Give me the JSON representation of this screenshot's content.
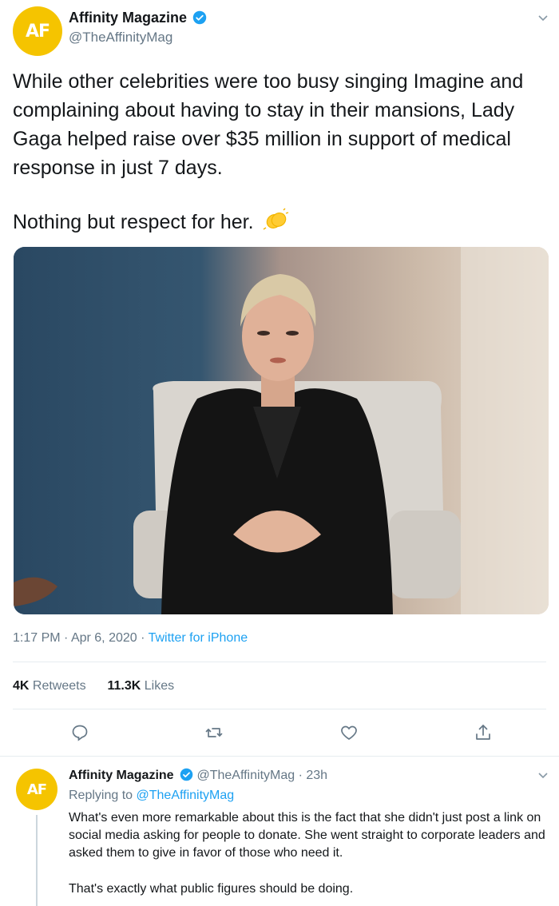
{
  "tweet": {
    "avatar_text": "AF",
    "name": "Affinity Magazine",
    "handle": "@TheAffinityMag",
    "text_p1": "While other celebrities were too busy singing Imagine and complaining about having to stay in their mansions, Lady Gaga helped raise over $35 million in support of medical response in just 7 days.",
    "text_p2": "Nothing but respect for her.",
    "time": "1:17 PM",
    "date": "Apr 6, 2020",
    "source": "Twitter for iPhone",
    "retweets_count": "4K",
    "retweets_label": "Retweets",
    "likes_count": "11.3K",
    "likes_label": "Likes"
  },
  "reply": {
    "avatar_text": "AF",
    "name": "Affinity Magazine",
    "handle": "@TheAffinityMag",
    "age": "23h",
    "replying_prefix": "Replying to",
    "replying_handle": "@TheAffinityMag",
    "text_p1": "What's even more remarkable about this is the fact that she didn't just post a link on social media asking for people to donate. She went straight to corporate leaders and asked them to give in favor of those who need it.",
    "text_p2": "That's exactly what public figures should be doing."
  },
  "colors": {
    "accent": "#1da1f2",
    "avatar_bg": "#f5c400",
    "muted": "#657786"
  }
}
